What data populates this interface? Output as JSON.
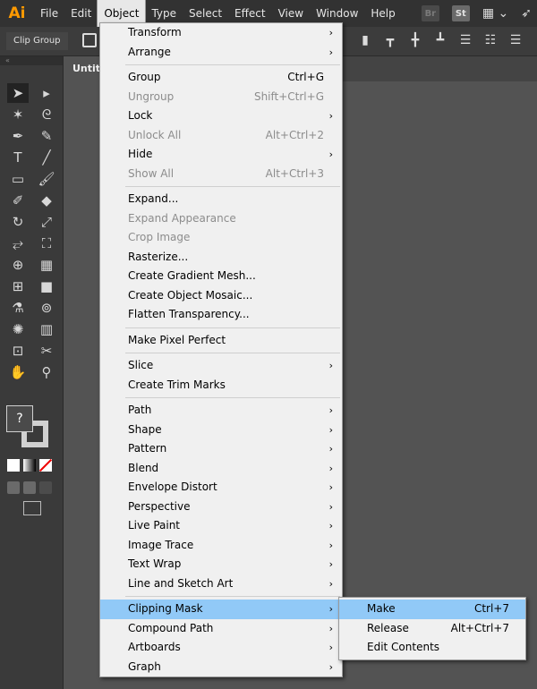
{
  "app": {
    "logo": "Ai"
  },
  "menubar": {
    "items": [
      "File",
      "Edit",
      "Object",
      "Type",
      "Select",
      "Effect",
      "View",
      "Window",
      "Help"
    ],
    "active": "Object",
    "bridge_badge": "Br",
    "stock_badge": "St"
  },
  "controlbar": {
    "selection_label": "Clip Group"
  },
  "document": {
    "tab_title": "Untitl"
  },
  "object_menu": {
    "groups": [
      [
        {
          "label": "Transform",
          "shortcut": "",
          "submenu": true,
          "disabled": false
        },
        {
          "label": "Arrange",
          "shortcut": "",
          "submenu": true,
          "disabled": false
        }
      ],
      [
        {
          "label": "Group",
          "shortcut": "Ctrl+G",
          "submenu": false,
          "disabled": false
        },
        {
          "label": "Ungroup",
          "shortcut": "Shift+Ctrl+G",
          "submenu": false,
          "disabled": true
        },
        {
          "label": "Lock",
          "shortcut": "",
          "submenu": true,
          "disabled": false
        },
        {
          "label": "Unlock All",
          "shortcut": "Alt+Ctrl+2",
          "submenu": false,
          "disabled": true
        },
        {
          "label": "Hide",
          "shortcut": "",
          "submenu": true,
          "disabled": false
        },
        {
          "label": "Show All",
          "shortcut": "Alt+Ctrl+3",
          "submenu": false,
          "disabled": true
        }
      ],
      [
        {
          "label": "Expand...",
          "shortcut": "",
          "submenu": false,
          "disabled": false
        },
        {
          "label": "Expand Appearance",
          "shortcut": "",
          "submenu": false,
          "disabled": true
        },
        {
          "label": "Crop Image",
          "shortcut": "",
          "submenu": false,
          "disabled": true
        },
        {
          "label": "Rasterize...",
          "shortcut": "",
          "submenu": false,
          "disabled": false
        },
        {
          "label": "Create Gradient Mesh...",
          "shortcut": "",
          "submenu": false,
          "disabled": false
        },
        {
          "label": "Create Object Mosaic...",
          "shortcut": "",
          "submenu": false,
          "disabled": false
        },
        {
          "label": "Flatten Transparency...",
          "shortcut": "",
          "submenu": false,
          "disabled": false
        }
      ],
      [
        {
          "label": "Make Pixel Perfect",
          "shortcut": "",
          "submenu": false,
          "disabled": false
        }
      ],
      [
        {
          "label": "Slice",
          "shortcut": "",
          "submenu": true,
          "disabled": false
        },
        {
          "label": "Create Trim Marks",
          "shortcut": "",
          "submenu": false,
          "disabled": false
        }
      ],
      [
        {
          "label": "Path",
          "shortcut": "",
          "submenu": true,
          "disabled": false
        },
        {
          "label": "Shape",
          "shortcut": "",
          "submenu": true,
          "disabled": false
        },
        {
          "label": "Pattern",
          "shortcut": "",
          "submenu": true,
          "disabled": false
        },
        {
          "label": "Blend",
          "shortcut": "",
          "submenu": true,
          "disabled": false
        },
        {
          "label": "Envelope Distort",
          "shortcut": "",
          "submenu": true,
          "disabled": false
        },
        {
          "label": "Perspective",
          "shortcut": "",
          "submenu": true,
          "disabled": false
        },
        {
          "label": "Live Paint",
          "shortcut": "",
          "submenu": true,
          "disabled": false
        },
        {
          "label": "Image Trace",
          "shortcut": "",
          "submenu": true,
          "disabled": false
        },
        {
          "label": "Text Wrap",
          "shortcut": "",
          "submenu": true,
          "disabled": false
        },
        {
          "label": "Line and Sketch Art",
          "shortcut": "",
          "submenu": true,
          "disabled": false
        }
      ],
      [
        {
          "label": "Clipping Mask",
          "shortcut": "",
          "submenu": true,
          "disabled": false,
          "highlight": true
        },
        {
          "label": "Compound Path",
          "shortcut": "",
          "submenu": true,
          "disabled": false
        },
        {
          "label": "Artboards",
          "shortcut": "",
          "submenu": true,
          "disabled": false
        },
        {
          "label": "Graph",
          "shortcut": "",
          "submenu": true,
          "disabled": false
        }
      ]
    ]
  },
  "clipping_submenu": {
    "items": [
      {
        "label": "Make",
        "shortcut": "Ctrl+7",
        "highlight": true
      },
      {
        "label": "Release",
        "shortcut": "Alt+Ctrl+7",
        "highlight": false
      },
      {
        "label": "Edit Contents",
        "shortcut": "",
        "highlight": false
      }
    ]
  },
  "tools": {
    "fill_unknown_label": "?",
    "icons": [
      [
        "selection-tool-icon",
        "direct-selection-tool-icon"
      ],
      [
        "magic-wand-tool-icon",
        "lasso-tool-icon"
      ],
      [
        "pen-tool-icon",
        "curvature-tool-icon"
      ],
      [
        "type-tool-icon",
        "line-segment-tool-icon"
      ],
      [
        "rectangle-tool-icon",
        "paintbrush-tool-icon"
      ],
      [
        "shaper-tool-icon",
        "eraser-tool-icon"
      ],
      [
        "rotate-tool-icon",
        "scale-tool-icon"
      ],
      [
        "width-tool-icon",
        "free-transform-tool-icon"
      ],
      [
        "shape-builder-tool-icon",
        "perspective-grid-tool-icon"
      ],
      [
        "mesh-tool-icon",
        "gradient-tool-icon"
      ],
      [
        "eyedropper-tool-icon",
        "blend-tool-icon"
      ],
      [
        "symbol-sprayer-tool-icon",
        "column-graph-tool-icon"
      ],
      [
        "artboard-tool-icon",
        "slice-tool-icon"
      ],
      [
        "hand-tool-icon",
        "zoom-tool-icon"
      ]
    ]
  }
}
